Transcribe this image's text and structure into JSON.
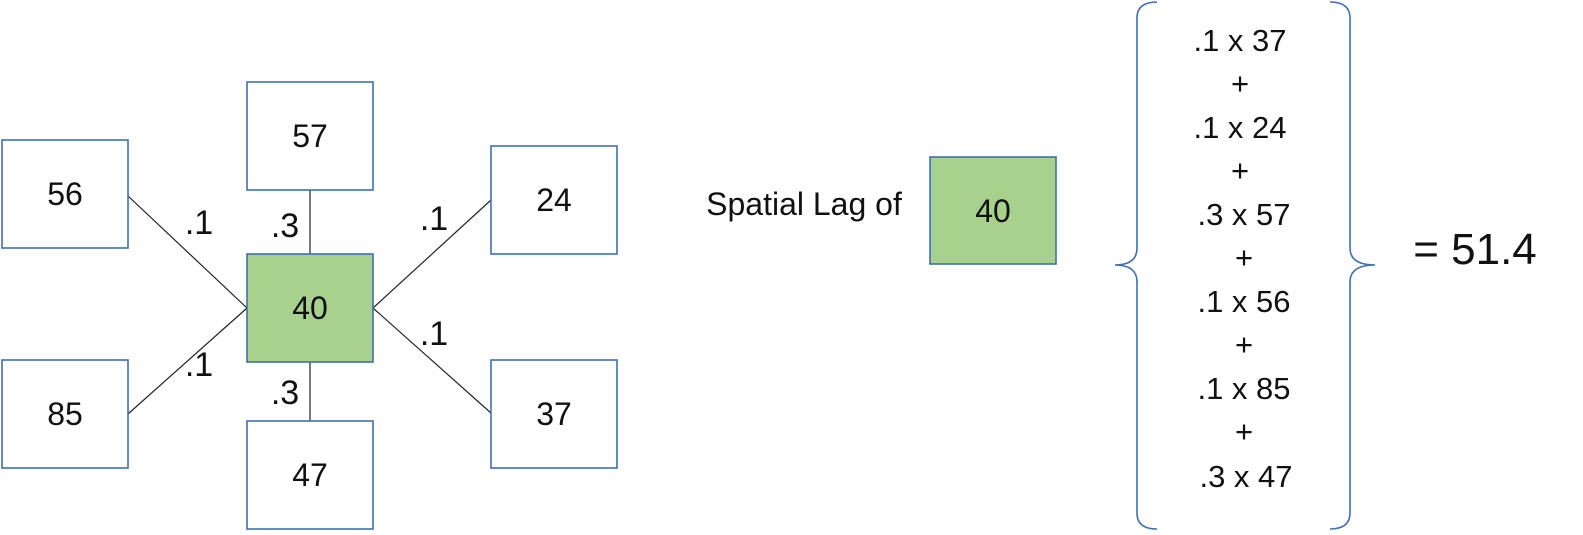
{
  "center": {
    "value": "40"
  },
  "neighbors": {
    "top": {
      "value": "57",
      "weight": ".3"
    },
    "bottom": {
      "value": "47",
      "weight": ".3"
    },
    "upper_left": {
      "value": "56",
      "weight": ".1"
    },
    "lower_left": {
      "value": "85",
      "weight": ".1"
    },
    "upper_right": {
      "value": "24",
      "weight": ".1"
    },
    "lower_right": {
      "value": "37",
      "weight": ".1"
    }
  },
  "lag": {
    "label": "Spatial Lag of",
    "box_value": "40",
    "terms": [
      ".1 x 37",
      ".1 x 24",
      ".3 x 57",
      ".1 x 56",
      ".1 x 85",
      ".3 x 47"
    ],
    "operator": "+",
    "result": "= 51.4"
  },
  "colors": {
    "center_fill": "#a9d18e",
    "box_border": "#3f6fb0"
  }
}
